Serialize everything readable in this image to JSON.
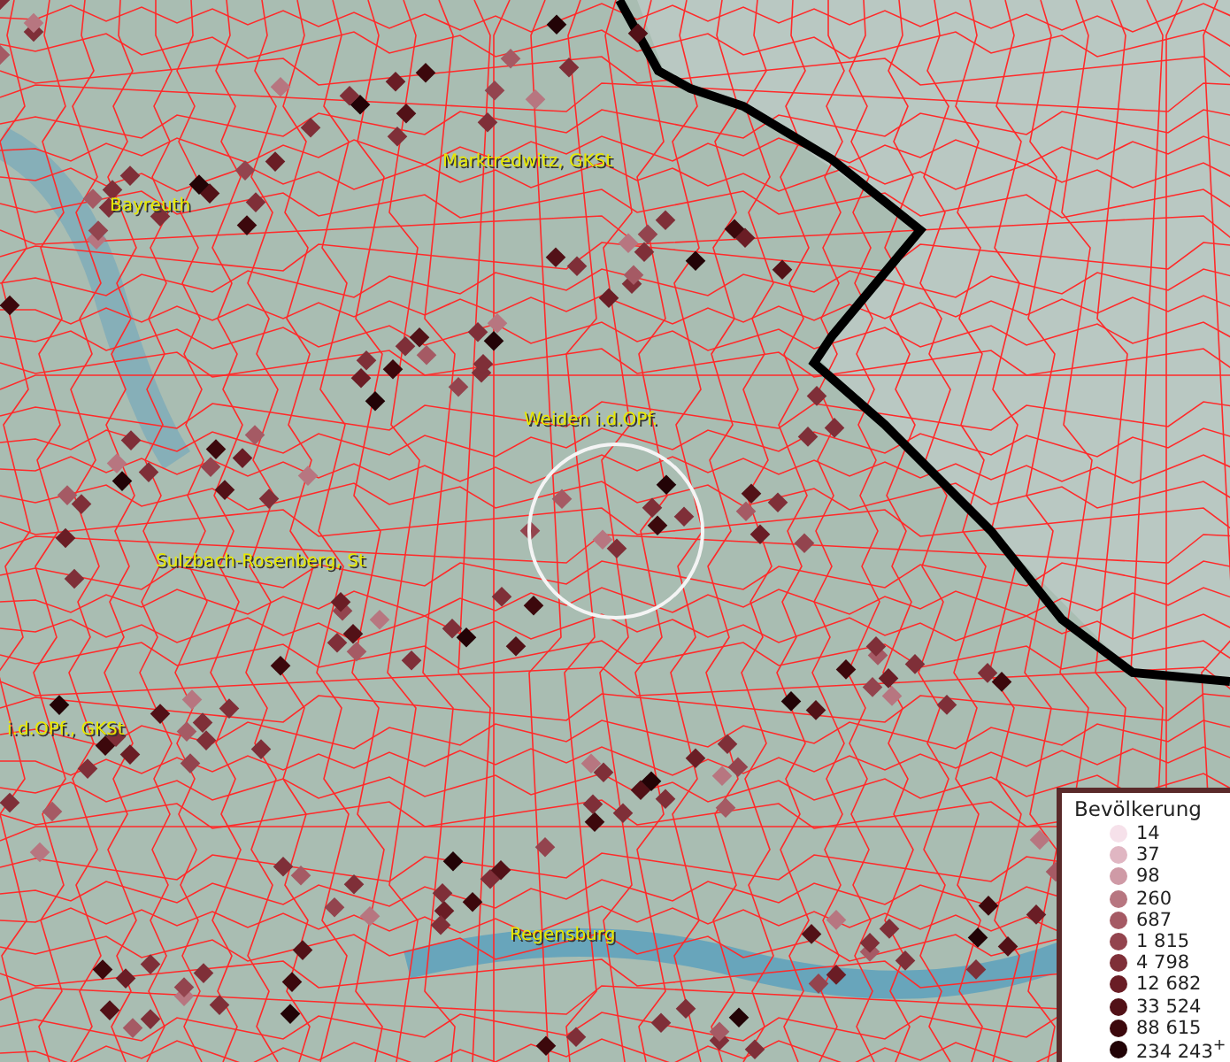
{
  "map": {
    "labels": [
      {
        "text": "Marktredwitz, GKSt"
      },
      {
        "text": "Bayreuth"
      },
      {
        "text": "Weiden i.d.OPf."
      },
      {
        "text": "Sulzbach-Rosenberg, St"
      },
      {
        "text": "i.d.OPf., GKSt"
      },
      {
        "text": "Regensburg"
      }
    ]
  },
  "legend": {
    "title": "Bevölkerung",
    "items": [
      {
        "label": "14",
        "color": "#f6e1ea"
      },
      {
        "label": "37",
        "color": "#e0b6c2"
      },
      {
        "label": "98",
        "color": "#cf9aa6"
      },
      {
        "label": "260",
        "color": "#b77680"
      },
      {
        "label": "687",
        "color": "#a55a64"
      },
      {
        "label": "1 815",
        "color": "#93444e"
      },
      {
        "label": "4 798",
        "color": "#7f2f38"
      },
      {
        "label": "12 682",
        "color": "#6a1d25"
      },
      {
        "label": "33 524",
        "color": "#521117"
      },
      {
        "label": "88 615",
        "color": "#3c080c"
      },
      {
        "label": "234 243$^{+}$",
        "color": "#220306"
      }
    ]
  }
}
